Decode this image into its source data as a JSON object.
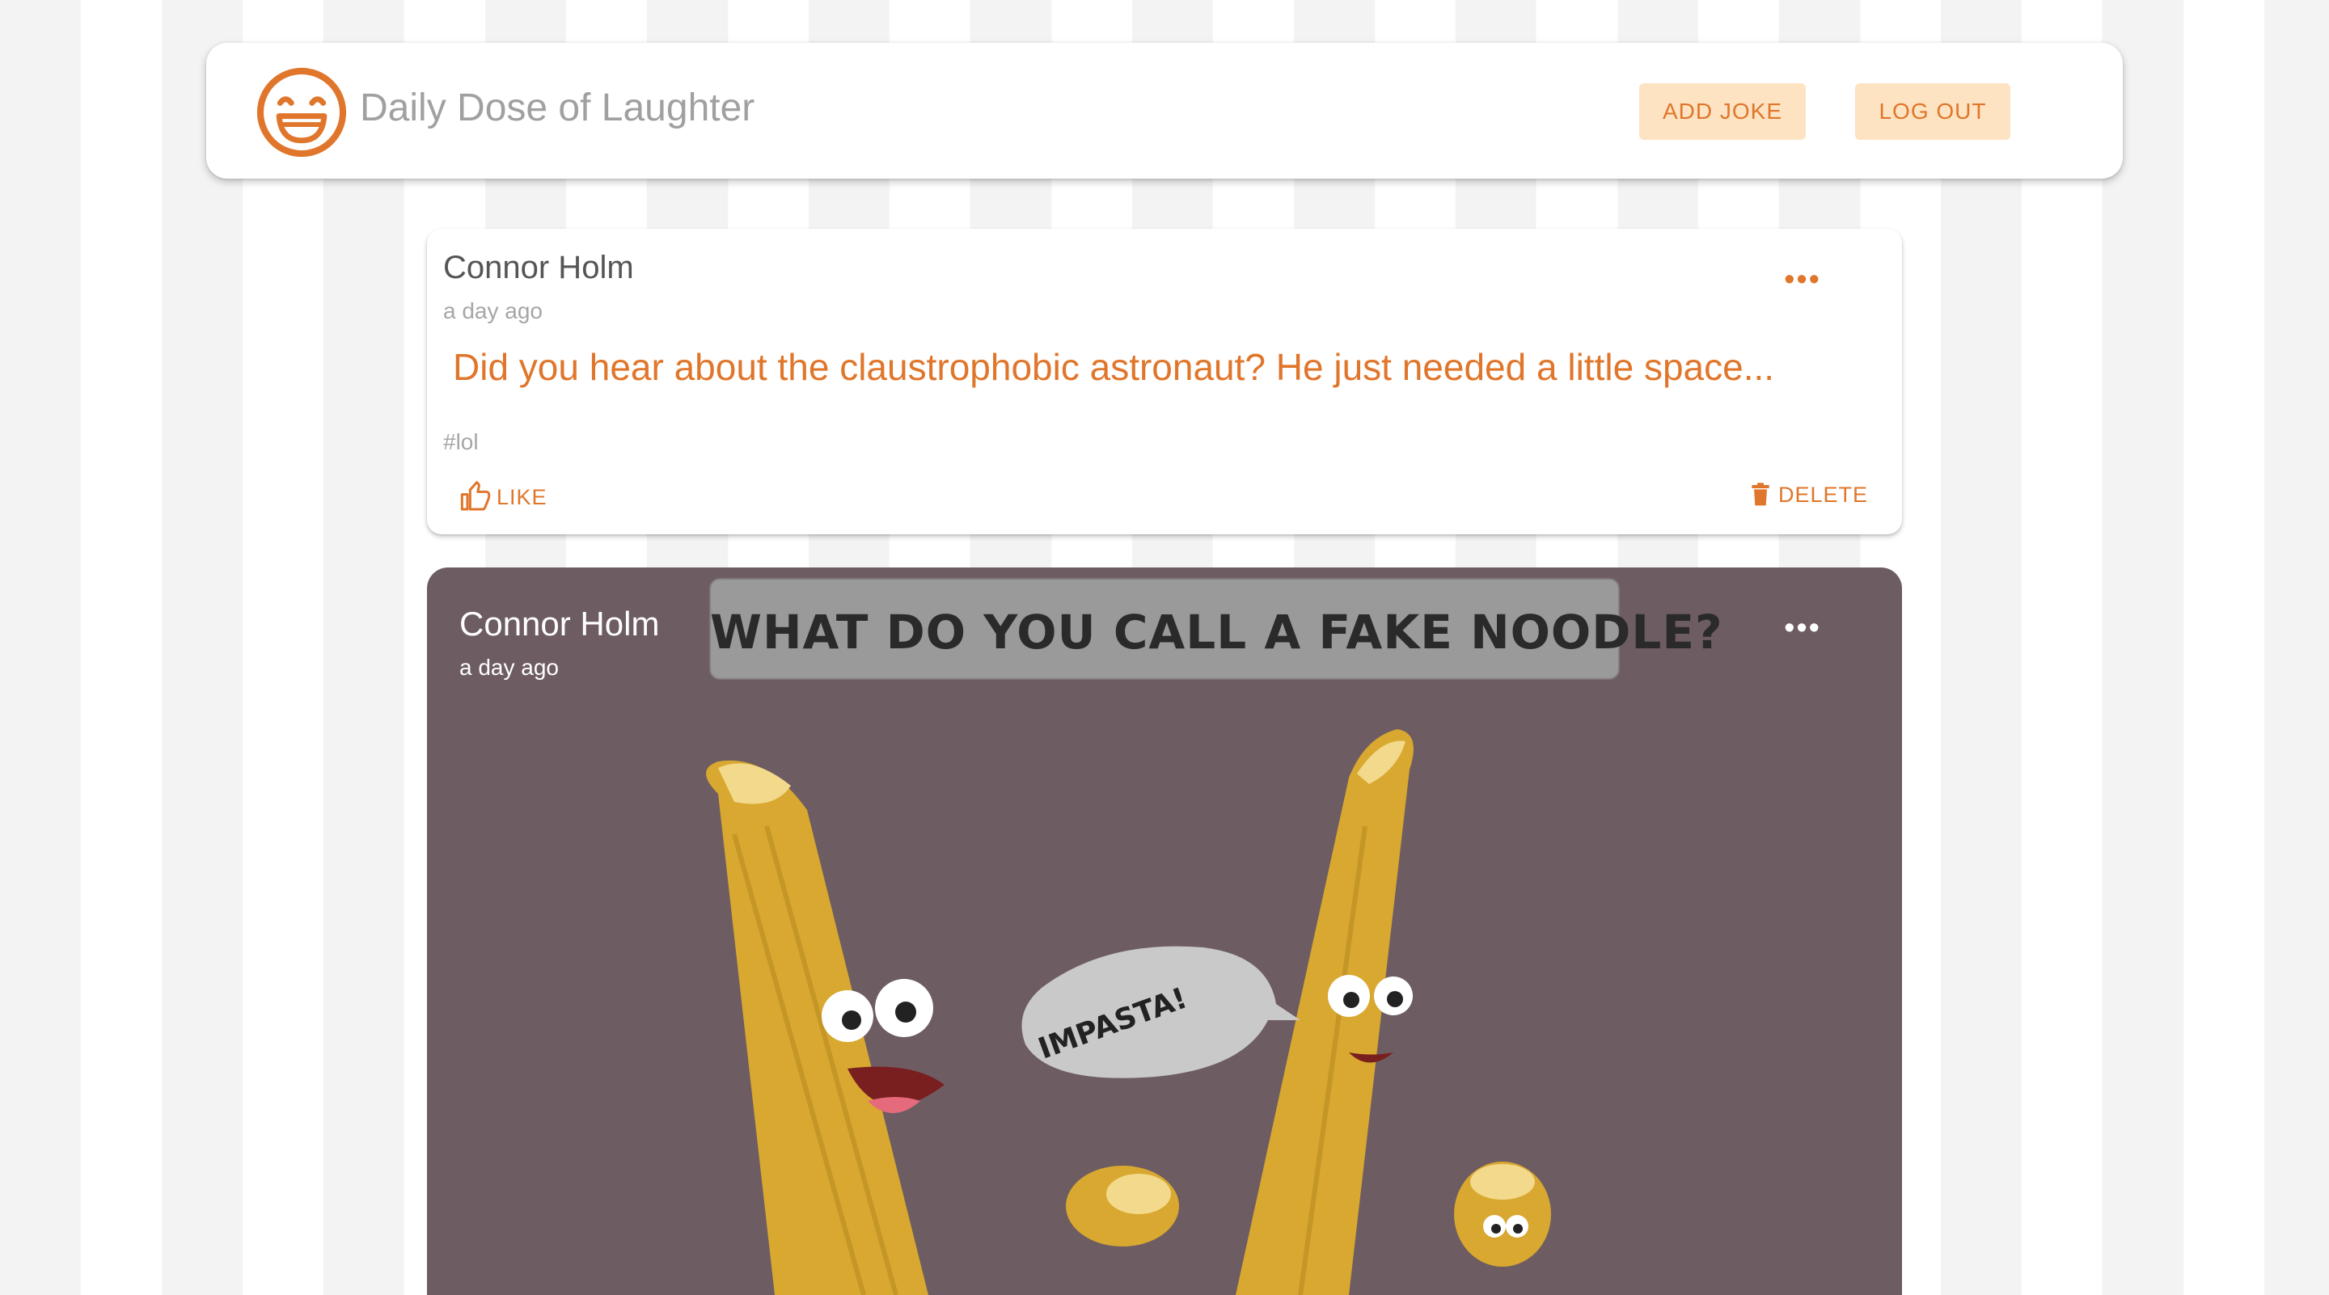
{
  "app": {
    "title": "Daily Dose of Laughter",
    "logo_icon": "smiley-face-icon",
    "accent_color": "#e0762b",
    "button_bg": "#fde3c2"
  },
  "nav": {
    "add_joke": "ADD JOKE",
    "log_out": "LOG OUT"
  },
  "posts": [
    {
      "author": "Connor Holm",
      "time": "a day ago",
      "joke": "Did you hear about the claustrophobic astronaut? He just needed a little space...",
      "hashtag": "#lol",
      "like_label": "LIKE",
      "delete_label": "DELETE",
      "more_icon": "more-horizontal-icon"
    },
    {
      "author": "Connor Holm",
      "time": "a day ago",
      "image_caption": "WHAT DO YOU CALL A FAKE NOODLE?",
      "speech_bubble": "IMPASTA!",
      "more_icon": "more-horizontal-icon"
    }
  ]
}
